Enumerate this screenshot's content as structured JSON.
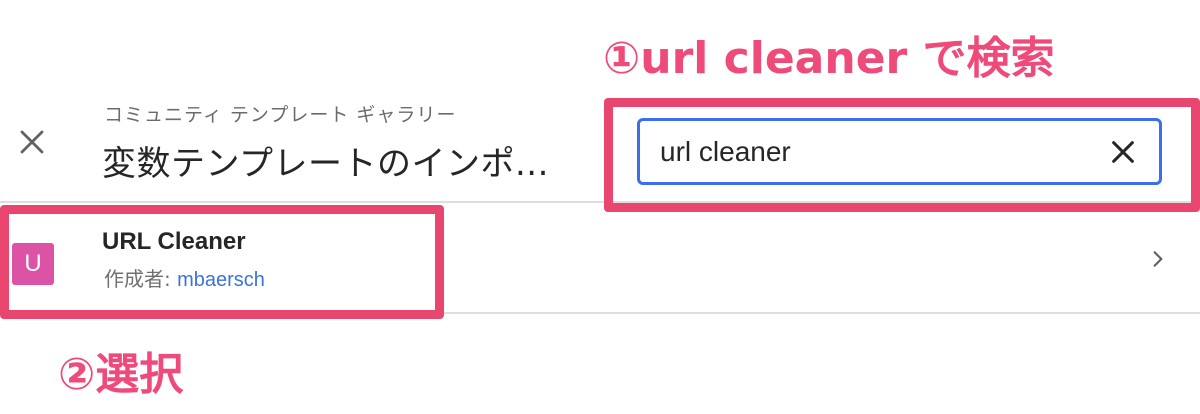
{
  "header": {
    "subtitle": "コミュニティ テンプレート ギャラリー",
    "title": "変数テンプレートのインポ..."
  },
  "search": {
    "value": "url cleaner"
  },
  "results": [
    {
      "avatar_letter": "U",
      "avatar_color": "#dc53a5",
      "name": "URL Cleaner",
      "author_label": "作成者: ",
      "author_name": "mbaersch"
    }
  ],
  "annotations": {
    "step1": "①url cleaner で検索",
    "step2": "②選択",
    "highlight_color": "#e8466e"
  },
  "icons": {
    "close": "close-icon",
    "clear": "clear-icon",
    "chevron": "chevron-right-icon"
  }
}
